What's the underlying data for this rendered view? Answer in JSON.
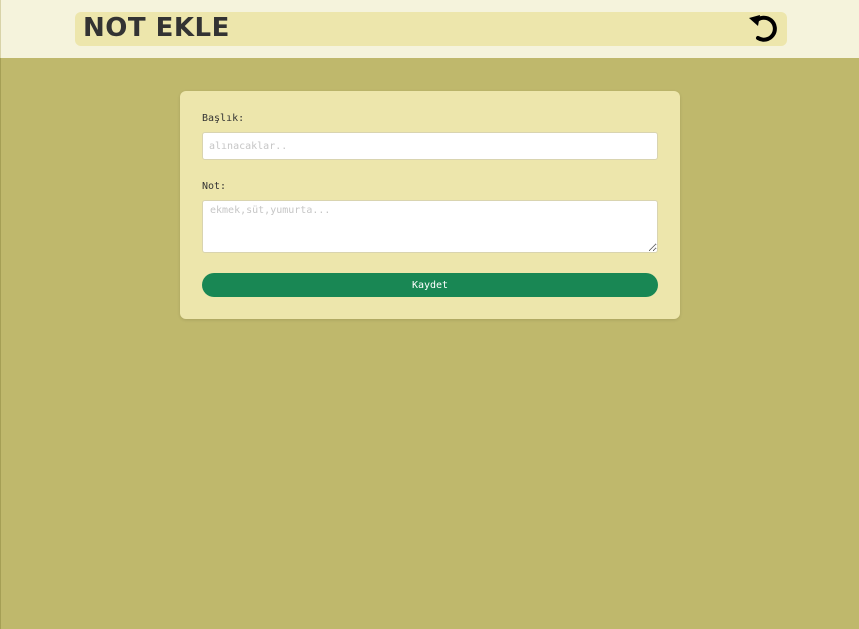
{
  "header": {
    "title": "NOT EKLE",
    "back_icon": "undo-arrow-icon"
  },
  "form": {
    "title_label": "Başlık:",
    "title_placeholder": "alınacaklar..",
    "title_value": "",
    "note_label": "Not:",
    "note_placeholder": "ekmek,süt,yumurta...",
    "note_value": "",
    "save_label": "Kaydet"
  },
  "colors": {
    "page_background": "#bfb86c",
    "header_background": "#f5f3dc",
    "title_bar_background": "#ede6ac",
    "card_background": "#ede6ac",
    "save_button": "#198754"
  }
}
